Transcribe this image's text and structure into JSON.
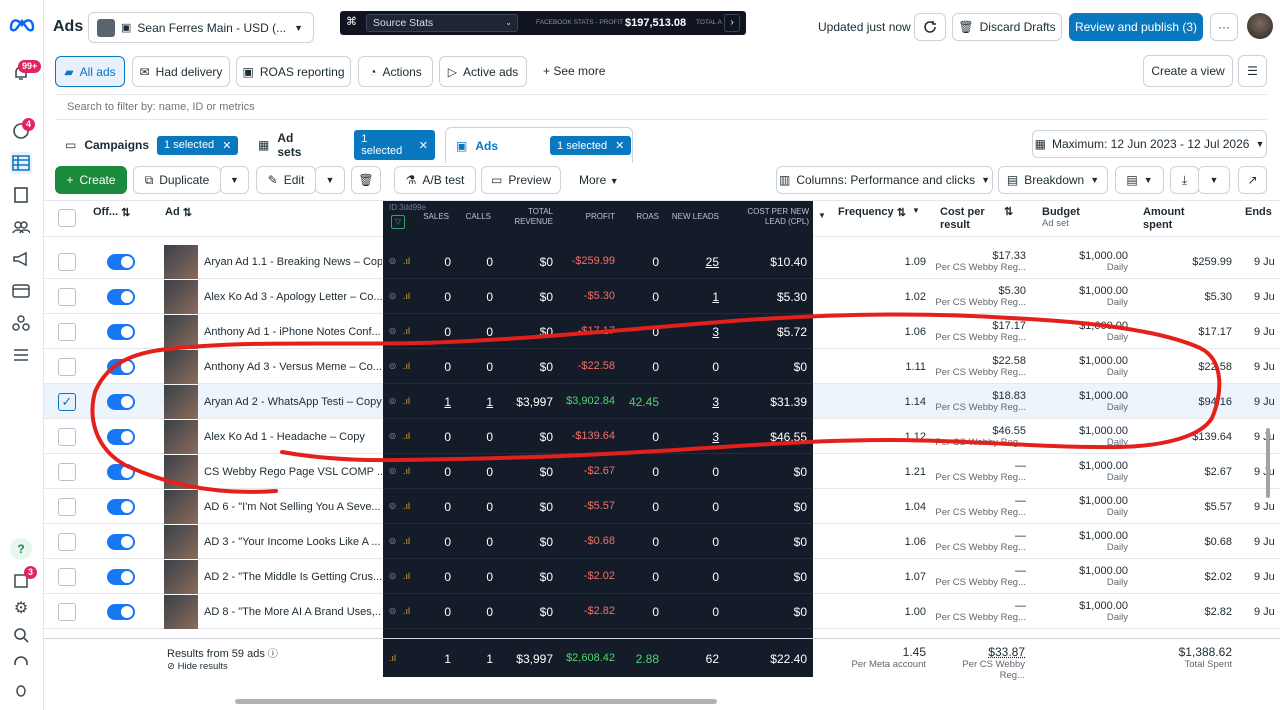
{
  "app": {
    "title": "Ads",
    "account": "Sean Ferres Main - USD (...",
    "updated": "Updated just now",
    "discard": "Discard Drafts",
    "review": "Review and publish (3)",
    "more": "···"
  },
  "overlay": {
    "source": "Source Stats",
    "fb_label": "FACEBOOK STATS - PROFIT",
    "fb_value": "$197,513.08",
    "total": "TOTAL A"
  },
  "sidebar": {
    "notif_badge": "99+",
    "badge2": "4",
    "badge3": "3"
  },
  "views": {
    "all_ads": "All ads",
    "had_delivery": "Had delivery",
    "roas": "ROAS reporting",
    "actions": "Actions",
    "active": "Active ads",
    "see_more": "See more",
    "create_view": "Create a view"
  },
  "search": {
    "placeholder": "Search to filter by: name, ID or metrics"
  },
  "levels": {
    "campaigns": "Campaigns",
    "adsets": "Ad sets",
    "ads": "Ads",
    "selected": "1 selected",
    "date": "Maximum: 12 Jun 2023 - 12 Jul 2026"
  },
  "toolbar": {
    "create": "Create",
    "duplicate": "Duplicate",
    "edit": "Edit",
    "ab": "A/B test",
    "preview": "Preview",
    "more": "More",
    "columns": "Columns: Performance and clicks",
    "breakdown": "Breakdown"
  },
  "headers": {
    "off": "Off...",
    "ad": "Ad",
    "id": "ID:3dd99e",
    "sales": "SALES",
    "calls": "CALLS",
    "total_rev": "TOTAL REVENUE",
    "profit": "PROFIT",
    "roas": "ROAS",
    "new_leads": "NEW LEADS",
    "cpl": "COST PER NEW LEAD (CPL)",
    "frequency": "Frequency",
    "cost_result": "Cost per result",
    "budget": "Budget",
    "budget_sub": "Ad set",
    "amount": "Amount spent",
    "ends": "Ends"
  },
  "rows": [
    {
      "name": "Aryan Ad 1.1 - Breaking News – Copy",
      "sales": "0",
      "calls": "0",
      "rev": "$0",
      "profit": "-$259.99",
      "roas": "0",
      "leads": "25",
      "cpl": "$10.40",
      "freq": "1.09",
      "cost": "$17.33",
      "cost_sub": "Per CS Webby Reg...",
      "budget": "$1,000.00",
      "budget_sub": "Daily",
      "amount": "$259.99",
      "ends": "9 Ju",
      "checked": false
    },
    {
      "name": "Alex Ko Ad 3 - Apology Letter – Co...",
      "sales": "0",
      "calls": "0",
      "rev": "$0",
      "profit": "-$5.30",
      "roas": "0",
      "leads": "1",
      "cpl": "$5.30",
      "freq": "1.02",
      "cost": "$5.30",
      "cost_sub": "Per CS Webby Reg...",
      "budget": "$1,000.00",
      "budget_sub": "Daily",
      "amount": "$5.30",
      "ends": "9 Ju",
      "checked": false
    },
    {
      "name": "Anthony Ad 1 - iPhone Notes Conf...",
      "sales": "0",
      "calls": "0",
      "rev": "$0",
      "profit": "-$17.17",
      "roas": "0",
      "leads": "3",
      "cpl": "$5.72",
      "freq": "1.06",
      "cost": "$17.17",
      "cost_sub": "Per CS Webby Reg...",
      "budget": "$1,000.00",
      "budget_sub": "Daily",
      "amount": "$17.17",
      "ends": "9 Ju",
      "checked": false
    },
    {
      "name": "Anthony Ad 3 - Versus Meme – Co...",
      "sales": "0",
      "calls": "0",
      "rev": "$0",
      "profit": "-$22.58",
      "roas": "0",
      "leads": "0",
      "cpl": "$0",
      "freq": "1.11",
      "cost": "$22.58",
      "cost_sub": "Per CS Webby Reg...",
      "budget": "$1,000.00",
      "budget_sub": "Daily",
      "amount": "$22.58",
      "ends": "9 Ju",
      "checked": false
    },
    {
      "name": "Aryan Ad 2 - WhatsApp Testi – Copy",
      "sales": "1",
      "calls": "1",
      "rev": "$3,997",
      "profit": "$3,902.84",
      "roas": "42.45",
      "leads": "3",
      "cpl": "$31.39",
      "freq": "1.14",
      "cost": "$18.83",
      "cost_sub": "Per CS Webby Reg...",
      "budget": "$1,000.00",
      "budget_sub": "Daily",
      "amount": "$94.16",
      "ends": "9 Ju",
      "checked": true
    },
    {
      "name": "Alex Ko Ad 1 - Headache – Copy",
      "sales": "0",
      "calls": "0",
      "rev": "$0",
      "profit": "-$139.64",
      "roas": "0",
      "leads": "3",
      "cpl": "$46.55",
      "freq": "1.12",
      "cost": "$46.55",
      "cost_sub": "Per CS Webby Reg...",
      "budget": "$1,000.00",
      "budget_sub": "Daily",
      "amount": "$139.64",
      "ends": "9 Ju",
      "checked": false
    },
    {
      "name": "CS Webby Rego Page VSL COMP ...",
      "sales": "0",
      "calls": "0",
      "rev": "$0",
      "profit": "-$2.67",
      "roas": "0",
      "leads": "0",
      "cpl": "$0",
      "freq": "1.21",
      "cost": "—",
      "cost_sub": "Per CS Webby Reg...",
      "budget": "$1,000.00",
      "budget_sub": "Daily",
      "amount": "$2.67",
      "ends": "9 Ju",
      "checked": false
    },
    {
      "name": "AD 6 - \"I'm Not Selling You A Seve...",
      "sales": "0",
      "calls": "0",
      "rev": "$0",
      "profit": "-$5.57",
      "roas": "0",
      "leads": "0",
      "cpl": "$0",
      "freq": "1.04",
      "cost": "—",
      "cost_sub": "Per CS Webby Reg...",
      "budget": "$1,000.00",
      "budget_sub": "Daily",
      "amount": "$5.57",
      "ends": "9 Ju",
      "checked": false
    },
    {
      "name": "AD 3 - \"Your Income Looks Like A ...",
      "sales": "0",
      "calls": "0",
      "rev": "$0",
      "profit": "-$0.68",
      "roas": "0",
      "leads": "0",
      "cpl": "$0",
      "freq": "1.06",
      "cost": "—",
      "cost_sub": "Per CS Webby Reg...",
      "budget": "$1,000.00",
      "budget_sub": "Daily",
      "amount": "$0.68",
      "ends": "9 Ju",
      "checked": false
    },
    {
      "name": "AD 2 - \"The Middle Is Getting Crus...",
      "sales": "0",
      "calls": "0",
      "rev": "$0",
      "profit": "-$2.02",
      "roas": "0",
      "leads": "0",
      "cpl": "$0",
      "freq": "1.07",
      "cost": "—",
      "cost_sub": "Per CS Webby Reg...",
      "budget": "$1,000.00",
      "budget_sub": "Daily",
      "amount": "$2.02",
      "ends": "9 Ju",
      "checked": false
    },
    {
      "name": "AD 8 - \"The More AI A Brand Uses,...",
      "sales": "0",
      "calls": "0",
      "rev": "$0",
      "profit": "-$2.82",
      "roas": "0",
      "leads": "0",
      "cpl": "$0",
      "freq": "1.00",
      "cost": "—",
      "cost_sub": "Per CS Webby Reg...",
      "budget": "$1,000.00",
      "budget_sub": "Daily",
      "amount": "$2.82",
      "ends": "9 Ju",
      "checked": false
    }
  ],
  "totals": {
    "label": "Results from 59 ads",
    "hide": "Hide results",
    "sales": "1",
    "calls": "1",
    "rev": "$3,997",
    "profit": "$2,608.42",
    "roas": "2.88",
    "leads": "62",
    "cpl": "$22.40",
    "freq": "1.45",
    "freq_sub": "Per Meta account",
    "cost": "$33.87",
    "cost_sub": "Per CS Webby Reg...",
    "amount": "$1,388.62",
    "amount_sub": "Total Spent"
  },
  "colors": {
    "accent": "#0a78be",
    "profit_neg": "#f0706a",
    "profit_pos": "#4ad66d",
    "annotation": "#e3201b"
  }
}
